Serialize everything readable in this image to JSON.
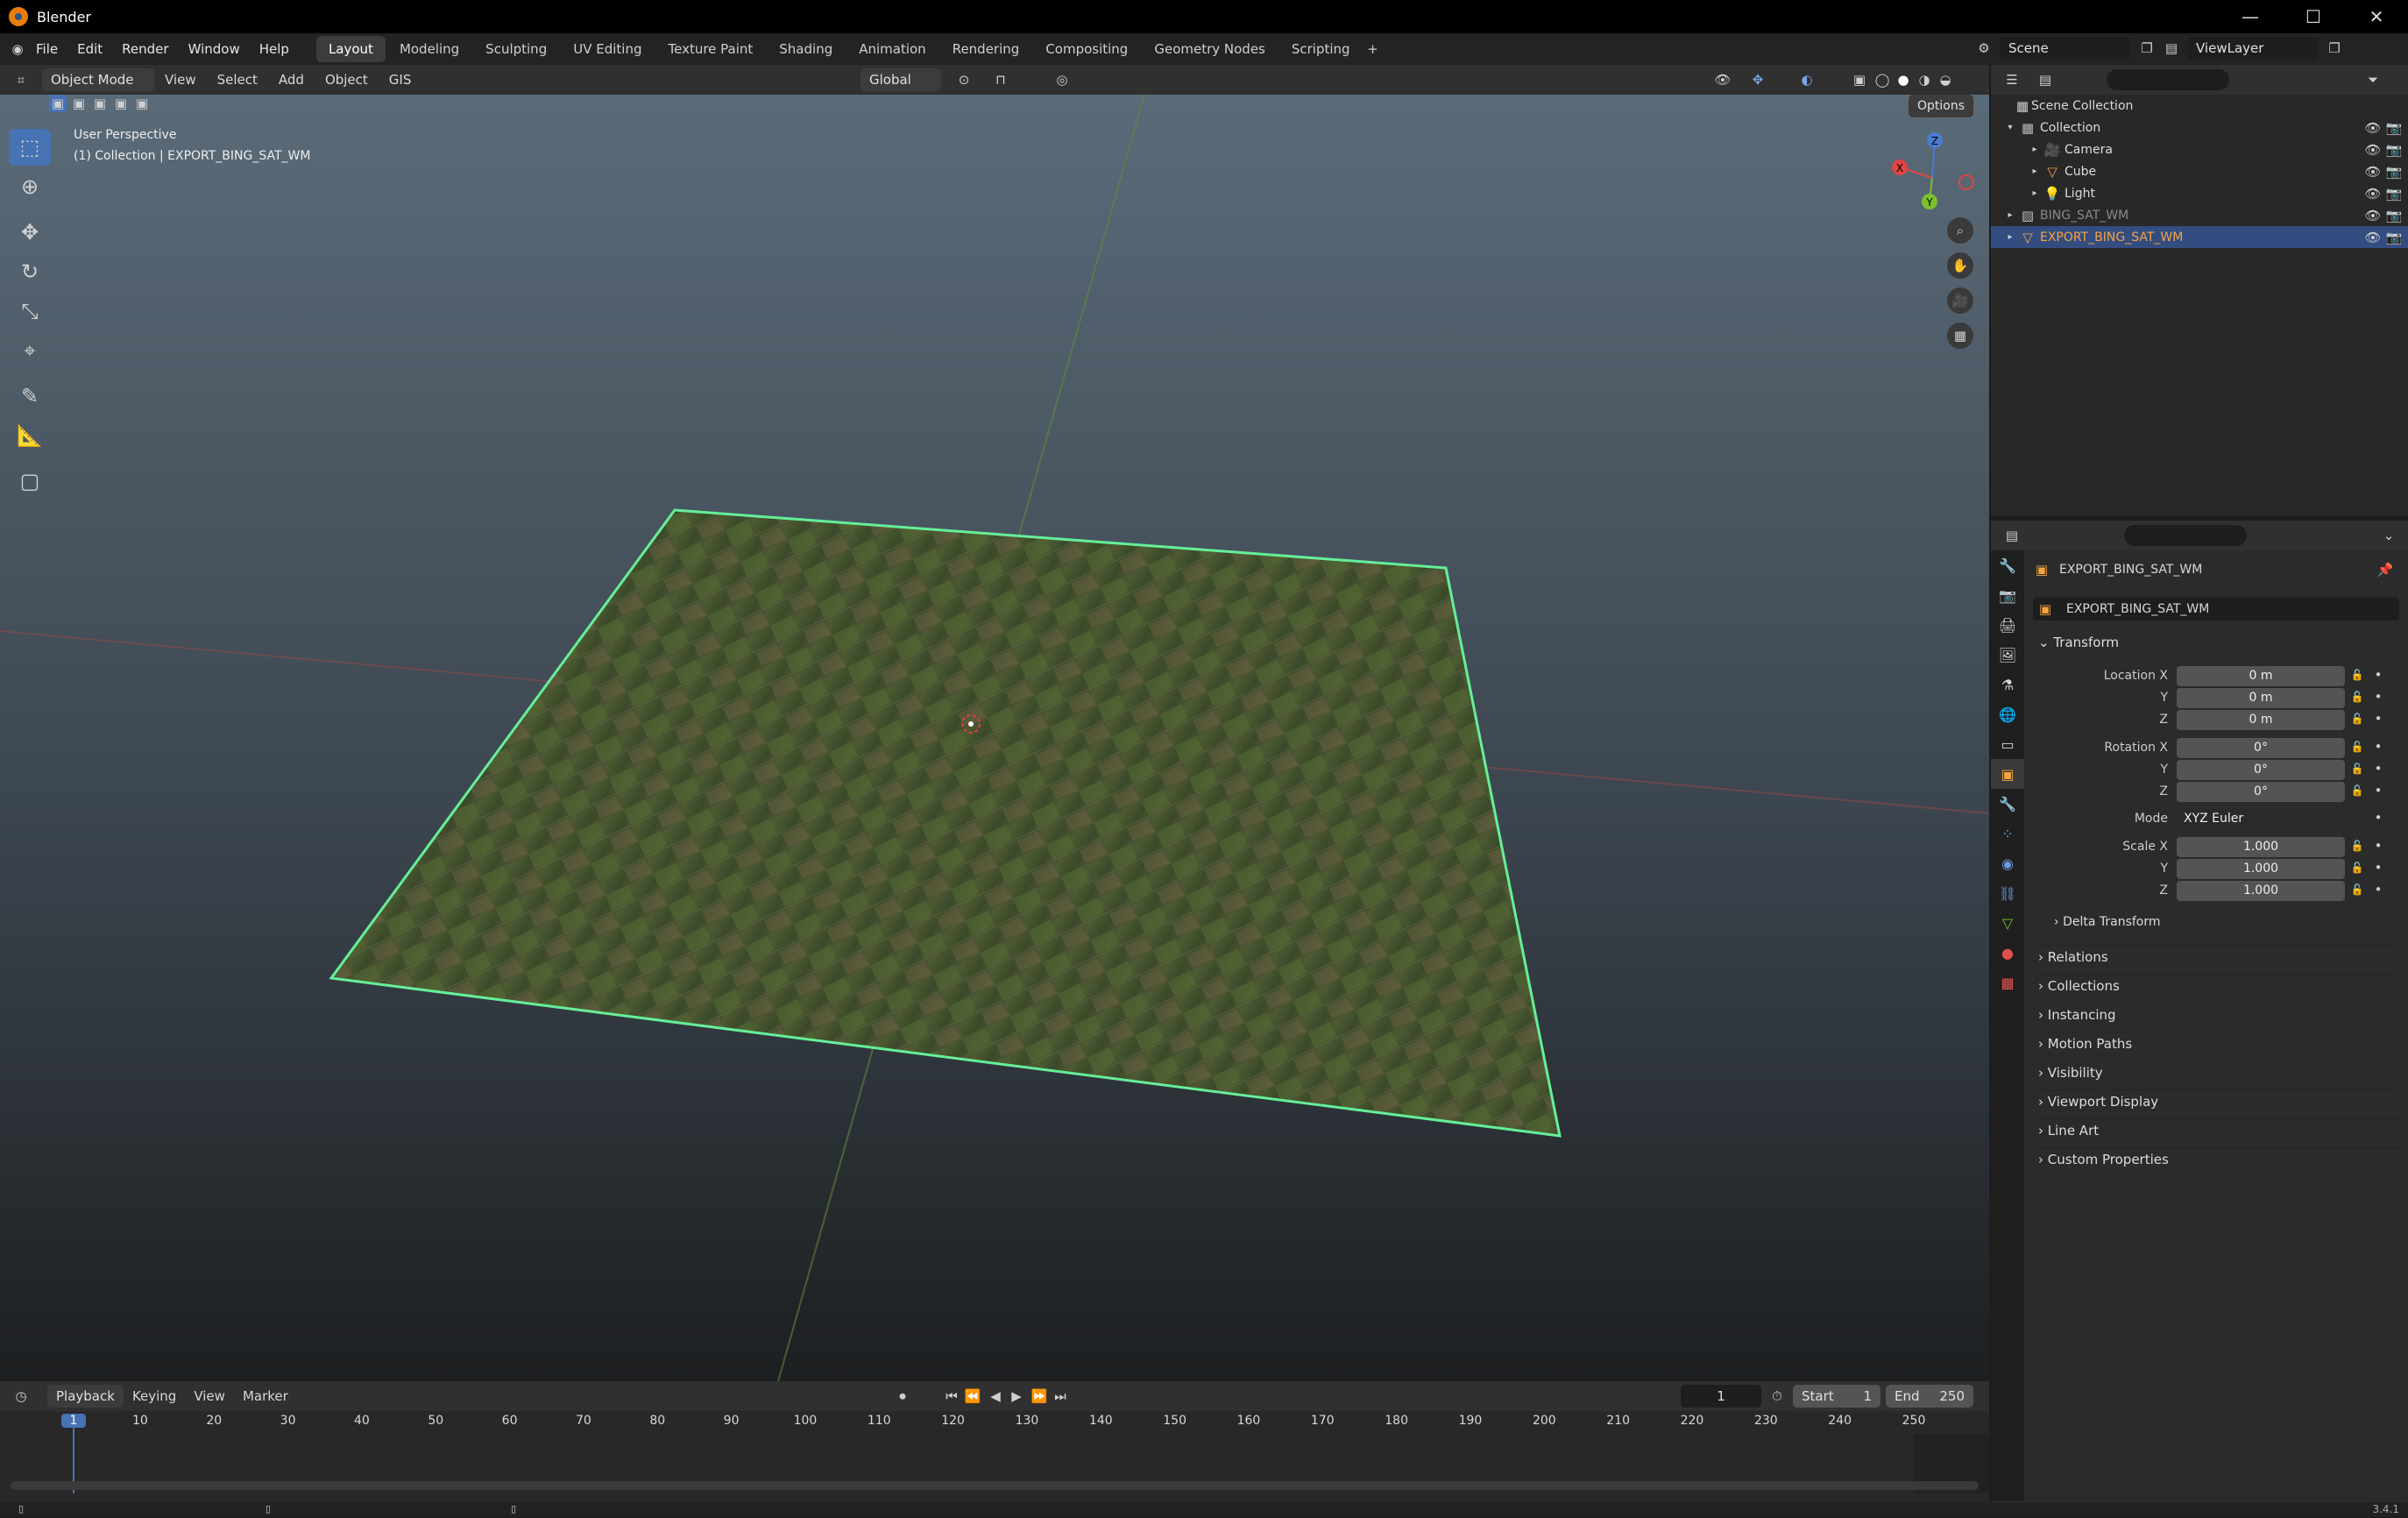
{
  "window": {
    "title": "Blender"
  },
  "menu": {
    "items": [
      "File",
      "Edit",
      "Render",
      "Window",
      "Help"
    ]
  },
  "workspaces": [
    "Layout",
    "Modeling",
    "Sculpting",
    "UV Editing",
    "Texture Paint",
    "Shading",
    "Animation",
    "Rendering",
    "Compositing",
    "Geometry Nodes",
    "Scripting"
  ],
  "active_workspace": "Layout",
  "scene": {
    "name": "Scene",
    "view_layer": "ViewLayer"
  },
  "viewport_header": {
    "mode": "Object Mode",
    "menus": [
      "View",
      "Select",
      "Add",
      "Object",
      "GIS"
    ],
    "transform_orientation": "Global",
    "options": "Options"
  },
  "viewport": {
    "overlay_line1": "User Perspective",
    "overlay_line2": "(1) Collection | EXPORT_BING_SAT_WM",
    "gizmo": {
      "x": "X",
      "y": "Y",
      "z": "Z"
    }
  },
  "outliner": {
    "root": "Scene Collection",
    "items": [
      {
        "label": "Collection",
        "type": "collection"
      },
      {
        "label": "Camera",
        "type": "camera"
      },
      {
        "label": "Cube",
        "type": "mesh"
      },
      {
        "label": "Light",
        "type": "light"
      },
      {
        "label": "BING_SAT_WM",
        "type": "image"
      },
      {
        "label": "EXPORT_BING_SAT_WM",
        "type": "mesh",
        "selected": true
      }
    ]
  },
  "properties": {
    "object_name": "EXPORT_BING_SAT_WM",
    "data_name": "EXPORT_BING_SAT_WM",
    "transform_label": "Transform",
    "location_label": "Location X",
    "rotation_label": "Rotation X",
    "scale_label": "Scale X",
    "y_label": "Y",
    "z_label": "Z",
    "location": [
      "0 m",
      "0 m",
      "0 m"
    ],
    "rotation": [
      "0°",
      "0°",
      "0°"
    ],
    "mode_label": "Mode",
    "mode_value": "XYZ Euler",
    "scale": [
      "1.000",
      "1.000",
      "1.000"
    ],
    "delta_transform": "Delta Transform",
    "panels": [
      "Relations",
      "Collections",
      "Instancing",
      "Motion Paths",
      "Visibility",
      "Viewport Display",
      "Line Art",
      "Custom Properties"
    ]
  },
  "timeline": {
    "menus": [
      "Playback",
      "Keying",
      "View",
      "Marker"
    ],
    "current_frame": "1",
    "start_label": "Start",
    "start": "1",
    "end_label": "End",
    "end": "250",
    "ticks": [
      "1",
      "10",
      "20",
      "30",
      "40",
      "50",
      "60",
      "70",
      "80",
      "90",
      "100",
      "110",
      "120",
      "130",
      "140",
      "150",
      "160",
      "170",
      "180",
      "190",
      "200",
      "210",
      "220",
      "230",
      "240",
      "250"
    ]
  },
  "status": {
    "version": "3.4.1"
  },
  "colors": {
    "accent": "#4772b3",
    "selected_outline": "#66ee99",
    "active_text": "#f5a442"
  }
}
